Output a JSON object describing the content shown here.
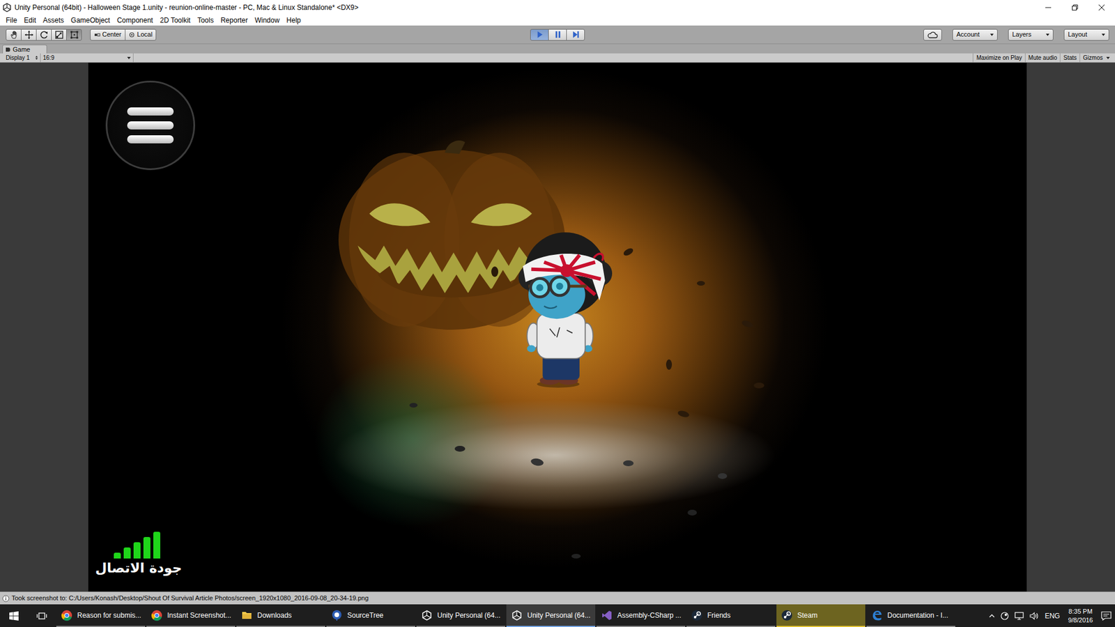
{
  "window": {
    "title": "Unity Personal (64bit) - Halloween Stage 1.unity - reunion-online-master - PC, Mac & Linux Standalone* <DX9>"
  },
  "menu": [
    "File",
    "Edit",
    "Assets",
    "GameObject",
    "Component",
    "2D Toolkit",
    "Tools",
    "Reporter",
    "Window",
    "Help"
  ],
  "toolbar": {
    "tools": [
      {
        "selected": false
      },
      {
        "selected": false
      },
      {
        "selected": false
      },
      {
        "selected": false
      },
      {
        "selected": true
      }
    ],
    "pivot": [
      "Center",
      "Local"
    ],
    "playback": [
      {
        "selected": true
      },
      {
        "selected": false
      },
      {
        "selected": false
      }
    ],
    "right": [
      "Account",
      "Layers",
      "Layout"
    ]
  },
  "tab": {
    "label": "Game"
  },
  "game_toolbar": {
    "display": "Display 1",
    "aspect": "16:9",
    "toggles": [
      {
        "label": "Maximize on Play",
        "selected": false,
        "kind": "toggle"
      },
      {
        "label": "Mute audio",
        "selected": false,
        "kind": "toggle"
      },
      {
        "label": "Stats",
        "selected": false,
        "kind": "toggle"
      },
      {
        "label": "Gizmos",
        "selected": false,
        "kind": "dropdown"
      }
    ]
  },
  "hud": {
    "connection": {
      "label": "جودة الاتصال",
      "level": 1
    }
  },
  "status_bar": "Took screenshot to: C:/Users/Konash/Desktop/Shout Of Survival Article Photos/screen_1920x1080_2016-09-08_20-34-19.png",
  "taskbar": {
    "items": [
      {
        "label": "Reason for submis...",
        "selected": false,
        "flashing": false
      },
      {
        "label": "Instant Screenshot...",
        "selected": false,
        "flashing": false
      },
      {
        "label": "Downloads",
        "selected": false,
        "flashing": false
      },
      {
        "label": "SourceTree",
        "selected": false,
        "flashing": false
      },
      {
        "label": "Unity Personal (64...",
        "selected": false,
        "flashing": false
      },
      {
        "label": "Unity Personal (64...",
        "selected": true,
        "flashing": false
      },
      {
        "label": "Assembly-CSharp ...",
        "selected": false,
        "flashing": false
      },
      {
        "label": "Friends",
        "selected": false,
        "flashing": false
      },
      {
        "label": "Steam",
        "selected": false,
        "flashing": true
      },
      {
        "label": "Documentation - I...",
        "selected": false,
        "flashing": false
      }
    ],
    "tray": {
      "language": "ENG",
      "time": "8:35 PM",
      "date": "9/8/2016"
    }
  }
}
